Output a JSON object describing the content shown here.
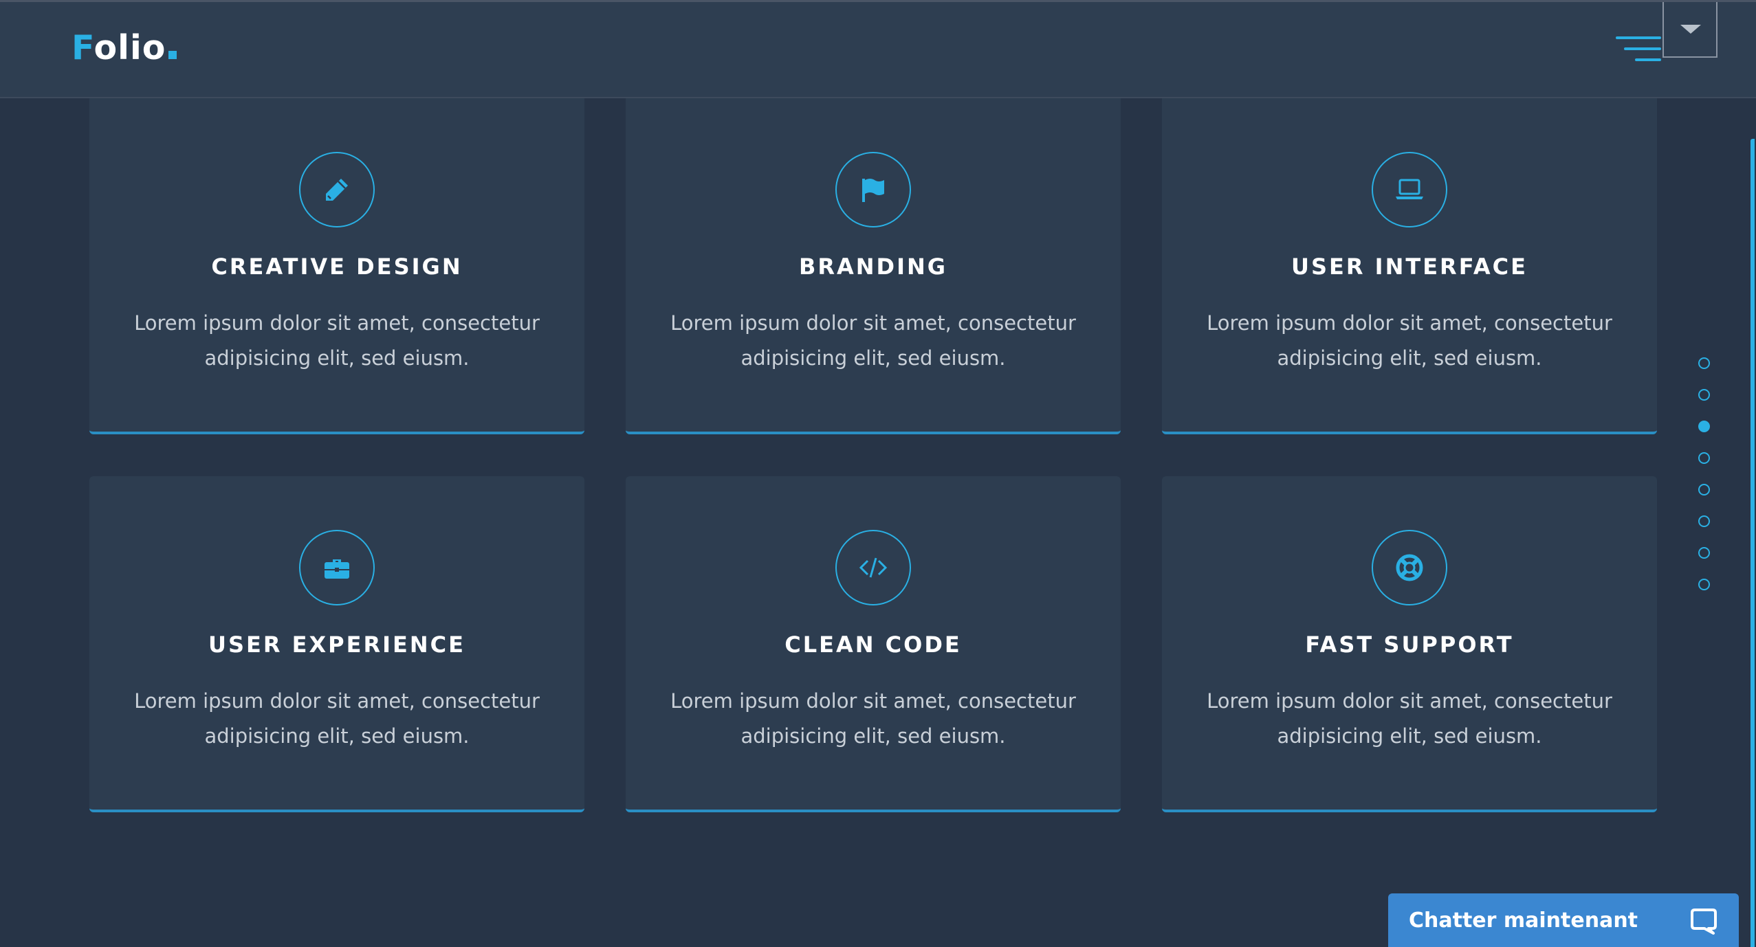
{
  "header": {
    "logo_first": "F",
    "logo_rest": "olio",
    "menu_icon": "hamburger-icon",
    "dropdown_icon": "caret-down-icon"
  },
  "services": [
    {
      "title": "CREATIVE DESIGN",
      "icon": "pencil-icon",
      "line1": "Lorem ipsum dolor sit amet, consectetur",
      "line2": "adipisicing elit, sed eiusm."
    },
    {
      "title": "BRANDING",
      "icon": "flag-icon",
      "line1": "Lorem ipsum dolor sit amet, consectetur",
      "line2": "adipisicing elit, sed eiusm."
    },
    {
      "title": "USER INTERFACE",
      "icon": "laptop-icon",
      "line1": "Lorem ipsum dolor sit amet, consectetur",
      "line2": "adipisicing elit, sed eiusm."
    },
    {
      "title": "USER EXPERIENCE",
      "icon": "briefcase-icon",
      "line1": "Lorem ipsum dolor sit amet, consectetur",
      "line2": "adipisicing elit, sed eiusm."
    },
    {
      "title": "CLEAN CODE",
      "icon": "code-icon",
      "line1": "Lorem ipsum dolor sit amet, consectetur",
      "line2": "adipisicing elit, sed eiusm."
    },
    {
      "title": "FAST SUPPORT",
      "icon": "lifebuoy-icon",
      "line1": "Lorem ipsum dolor sit amet, consectetur",
      "line2": "adipisicing elit, sed eiusm."
    }
  ],
  "side_nav": {
    "count": 8,
    "active_index": 2
  },
  "chat": {
    "label": "Chatter maintenant",
    "icon": "chat-bubble-icon"
  },
  "colors": {
    "accent": "#2ab0e4",
    "background": "#273447",
    "card": "#2d3d50",
    "chat": "#3b87d1"
  }
}
